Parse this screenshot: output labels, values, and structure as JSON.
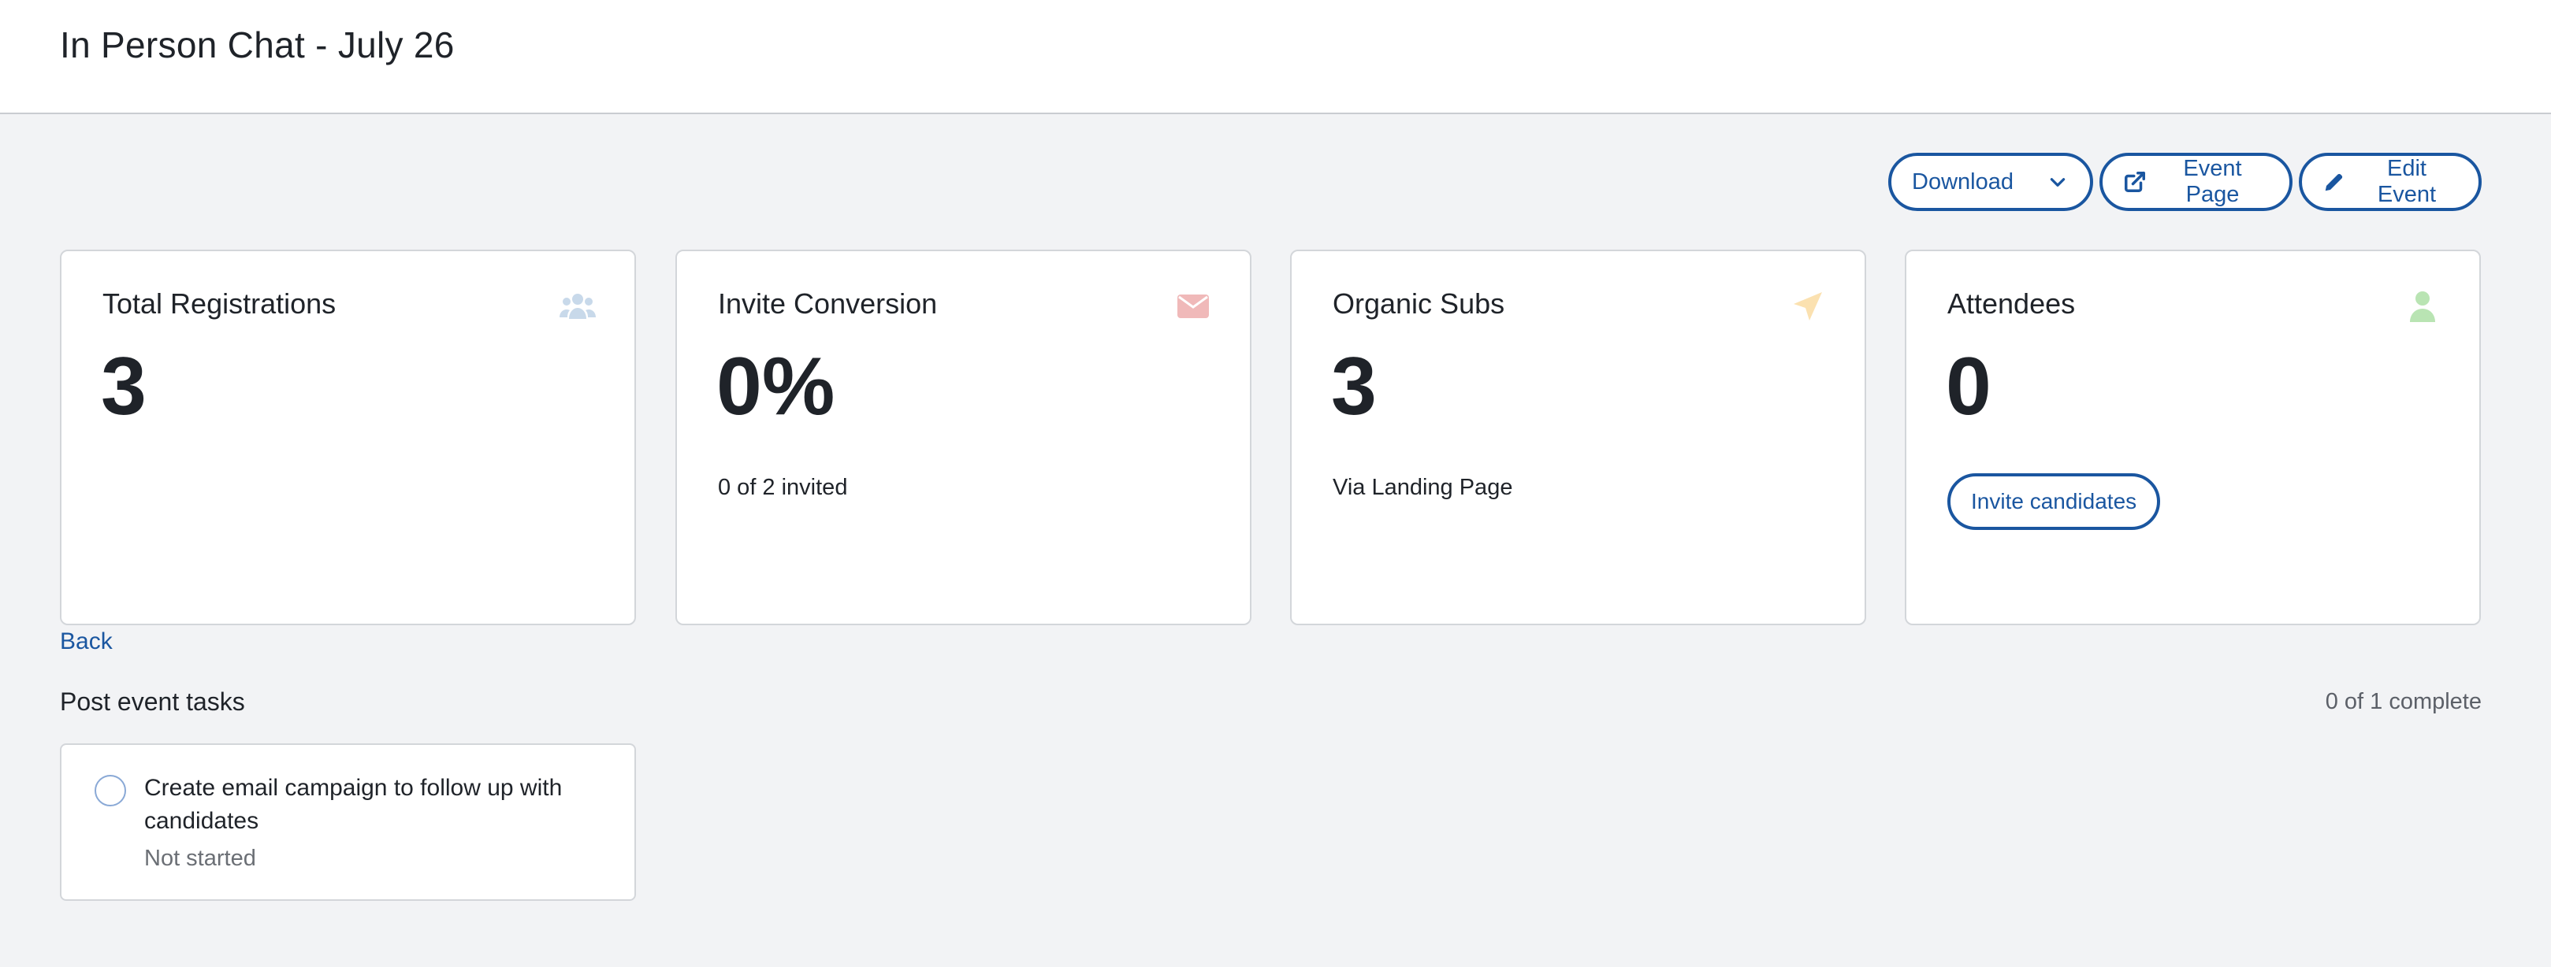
{
  "header": {
    "title": "In Person Chat - July 26"
  },
  "toolbar": {
    "download_label": "Download",
    "event_page_label": "Event Page",
    "edit_event_label": "Edit Event"
  },
  "cards": [
    {
      "title": "Total Registrations",
      "value": "3",
      "icon": "users-icon",
      "icon_color": "#c8d9ea"
    },
    {
      "title": "Invite Conversion",
      "value": "0%",
      "subtitle": "0 of 2 invited",
      "icon": "envelope-icon",
      "icon_color": "#f0b9b9"
    },
    {
      "title": "Organic Subs",
      "value": "3",
      "subtitle": "Via Landing Page",
      "icon": "paper-plane-icon",
      "icon_color": "#fbe1b0"
    },
    {
      "title": "Attendees",
      "value": "0",
      "button_label": "Invite candidates",
      "icon": "user-icon",
      "icon_color": "#b9e4b3"
    }
  ],
  "back_label": "Back",
  "tasks": {
    "heading": "Post event tasks",
    "count_text": "0 of 1 complete",
    "items": [
      {
        "title": "Create email campaign to follow up with candidates",
        "status": "Not started"
      }
    ]
  },
  "colors": {
    "accent": "#1a56a0",
    "background": "#f2f3f5"
  }
}
